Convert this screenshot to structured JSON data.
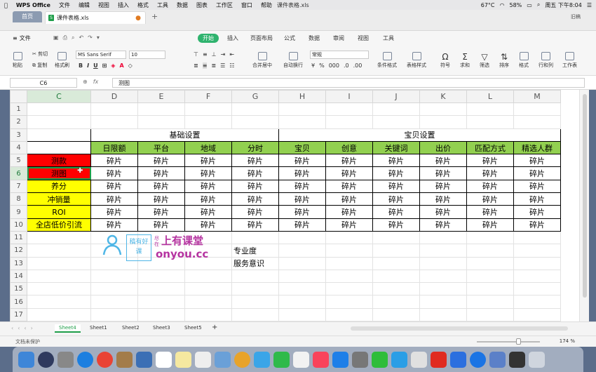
{
  "macos": {
    "menu": [
      "WPS Office",
      "文件",
      "编辑",
      "视图",
      "插入",
      "格式",
      "工具",
      "数据",
      "图表",
      "工作区",
      "窗口",
      "帮助"
    ],
    "window_title": "课件表格.xls",
    "status": {
      "temp": "67°C",
      "battery": "58%",
      "clock": "周五 下午8:04"
    }
  },
  "tabs": {
    "home": "首页",
    "file": "课件表格.xls",
    "user": "旧稿"
  },
  "ribbon_tabs": [
    "开始",
    "插入",
    "页面布局",
    "公式",
    "数据",
    "审阅",
    "视图",
    "工具"
  ],
  "menu_label": "文件",
  "toolbar": {
    "cut": "剪切",
    "copy": "复制",
    "paste": "粘贴",
    "format_painter": "格式刷",
    "font": "MS Sans Serif",
    "size": "10",
    "number_format": "常规",
    "merge": "合并居中",
    "wrap": "自动换行",
    "cond_format": "条件格式",
    "table_style": "表格样式",
    "symbol": "符号",
    "sum": "求和",
    "filter": "筛选",
    "sort": "排序",
    "format": "格式",
    "rowcol": "行和列",
    "worksheet": "工作表",
    "font_buttons": [
      "B",
      "I",
      "U"
    ]
  },
  "formula": {
    "cell": "C6",
    "content": "测图"
  },
  "columns": [
    "C",
    "D",
    "E",
    "F",
    "G",
    "H",
    "I",
    "J",
    "K",
    "L",
    "M"
  ],
  "rows": [
    "1",
    "2",
    "3",
    "4",
    "5",
    "6",
    "7",
    "8",
    "9",
    "10",
    "11",
    "12",
    "13",
    "14",
    "15",
    "16",
    "17"
  ],
  "table": {
    "group1": "基础设置",
    "group2": "宝贝设置",
    "headers": [
      "日限额",
      "平台",
      "地域",
      "分时",
      "宝贝",
      "创意",
      "关键词",
      "出价",
      "匹配方式",
      "精选人群"
    ],
    "row_labels": [
      "测款",
      "测图",
      "养分",
      "冲销量",
      "ROI",
      "全店低价引流"
    ],
    "cell_value": "碎片"
  },
  "notes": [
    "专业度",
    "服务意识"
  ],
  "watermark": {
    "badge": "稿有好课",
    "small": "尽在",
    "cn": "上有课堂",
    "en": "onyou.cc"
  },
  "sheets": [
    "Sheet4",
    "Sheet1",
    "Sheet2",
    "Sheet3",
    "Sheet5"
  ],
  "status": {
    "protect": "文档未保护",
    "zoom": "174 %"
  }
}
